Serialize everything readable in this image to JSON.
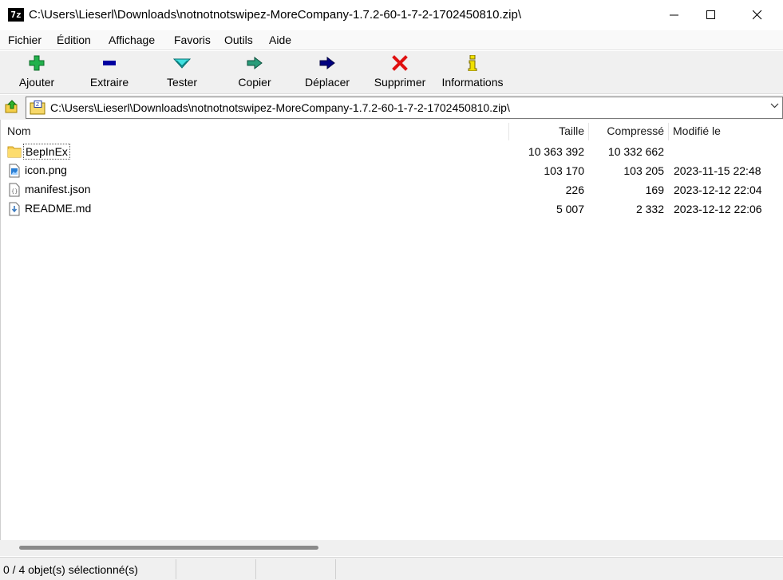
{
  "window": {
    "title": "C:\\Users\\Lieserl\\Downloads\\notnotnotswipez-MoreCompany-1.7.2-60-1-7-2-1702450810.zip\\",
    "app_icon_text": "7z",
    "controls": [
      "minimize-icon",
      "maximize-icon",
      "close-icon"
    ]
  },
  "menu": {
    "items": [
      "Fichier",
      "Édition",
      "Affichage",
      "Favoris",
      "Outils",
      "Aide"
    ]
  },
  "toolbar": {
    "buttons": [
      {
        "label": "Ajouter",
        "icon": "plus-icon",
        "color": "#22b14c"
      },
      {
        "label": "Extraire",
        "icon": "minus-icon",
        "color": "#0000a0"
      },
      {
        "label": "Tester",
        "icon": "check-chevron-icon",
        "color": "#1fb5b5"
      },
      {
        "label": "Copier",
        "icon": "copy-arrow-icon",
        "color": "#2a9c7a"
      },
      {
        "label": "Déplacer",
        "icon": "move-arrow-icon",
        "color": "#000080"
      },
      {
        "label": "Supprimer",
        "icon": "delete-x-icon",
        "color": "#e01010"
      },
      {
        "label": "Informations",
        "icon": "info-icon",
        "color": "#e8d800"
      }
    ]
  },
  "address": {
    "path": "C:\\Users\\Lieserl\\Downloads\\notnotnotswipez-MoreCompany-1.7.2-60-1-7-2-1702450810.zip\\"
  },
  "columns": {
    "name": "Nom",
    "size": "Taille",
    "packed": "Compressé",
    "modified": "Modifié le"
  },
  "files": [
    {
      "name": "BepInEx",
      "type": "folder",
      "size": "10 363 392",
      "packed": "10 332 662",
      "modified": ""
    },
    {
      "name": "icon.png",
      "type": "image",
      "size": "103 170",
      "packed": "103 205",
      "modified": "2023-11-15 22:48"
    },
    {
      "name": "manifest.json",
      "type": "json",
      "size": "226",
      "packed": "169",
      "modified": "2023-12-12 22:04"
    },
    {
      "name": "README.md",
      "type": "markdown",
      "size": "5 007",
      "packed": "2 332",
      "modified": "2023-12-12 22:06"
    }
  ],
  "status": {
    "text": "0 / 4 objet(s) sélectionné(s)"
  }
}
